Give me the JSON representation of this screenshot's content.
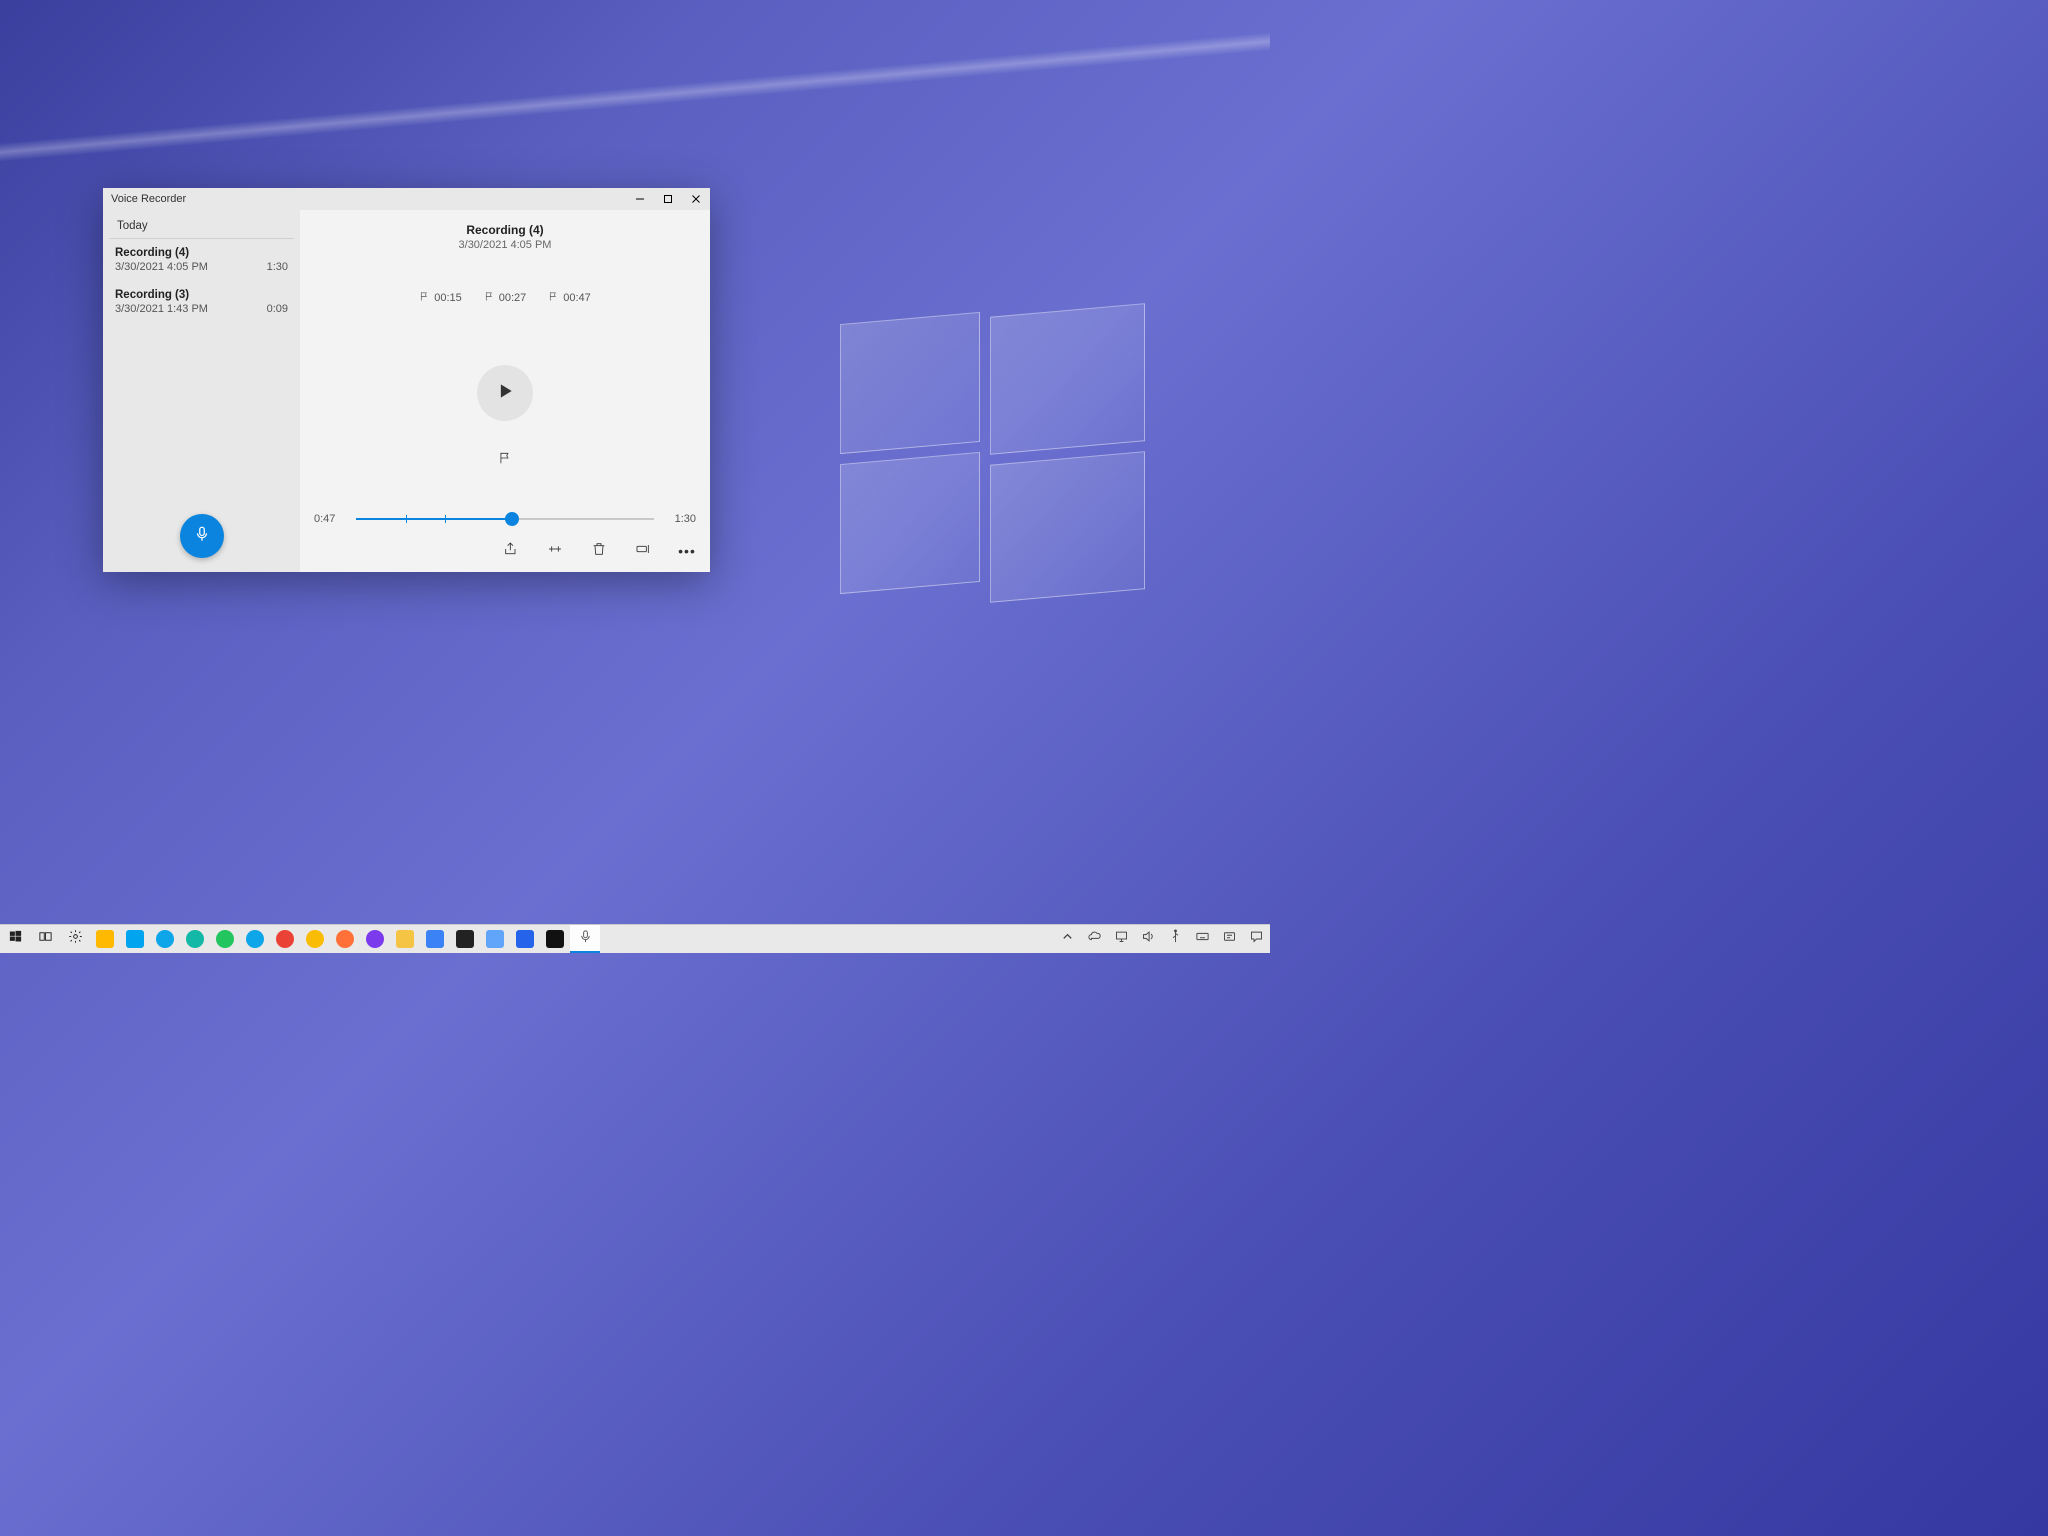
{
  "app": {
    "title": "Voice Recorder",
    "sidebar": {
      "section": "Today",
      "items": [
        {
          "name": "Recording (4)",
          "date": "3/30/2021 4:05 PM",
          "duration": "1:30",
          "selected": true
        },
        {
          "name": "Recording (3)",
          "date": "3/30/2021 1:43 PM",
          "duration": "0:09",
          "selected": false
        }
      ]
    },
    "detail": {
      "title": "Recording (4)",
      "date": "3/30/2021 4:05 PM",
      "markers": [
        "00:15",
        "00:27",
        "00:47"
      ],
      "current_time": "0:47",
      "total_time": "1:30",
      "progress_seconds": 47,
      "total_seconds": 90,
      "marker_seconds": [
        15,
        27,
        47
      ]
    }
  },
  "taskbar": {
    "apps": [
      {
        "name": "start",
        "kind": "svg-win",
        "color": "#222"
      },
      {
        "name": "task-view",
        "kind": "svg-taskview",
        "color": "#222"
      },
      {
        "name": "settings",
        "kind": "svg-gear",
        "color": "#222"
      },
      {
        "name": "store",
        "kind": "square",
        "color": "#ffb900"
      },
      {
        "name": "phone",
        "kind": "square",
        "color": "#00a4ef"
      },
      {
        "name": "edge",
        "kind": "circle",
        "color": "#0ea5e9"
      },
      {
        "name": "edge-dev",
        "kind": "circle",
        "color": "#14b8a6"
      },
      {
        "name": "edge-beta",
        "kind": "circle",
        "color": "#22c55e"
      },
      {
        "name": "edge-canary",
        "kind": "circle",
        "color": "#0ea5e9"
      },
      {
        "name": "chrome",
        "kind": "circle",
        "color": "#ea4335"
      },
      {
        "name": "chrome-canary",
        "kind": "circle",
        "color": "#fbbc05"
      },
      {
        "name": "firefox",
        "kind": "circle",
        "color": "#ff7139"
      },
      {
        "name": "firefox-dev",
        "kind": "circle",
        "color": "#7c3aed"
      },
      {
        "name": "explorer",
        "kind": "square",
        "color": "#f6c445"
      },
      {
        "name": "mail",
        "kind": "square",
        "color": "#3b82f6"
      },
      {
        "name": "terminal",
        "kind": "square",
        "color": "#222"
      },
      {
        "name": "app1",
        "kind": "square",
        "color": "#60a5fa"
      },
      {
        "name": "photos",
        "kind": "square",
        "color": "#2563eb"
      },
      {
        "name": "cmd",
        "kind": "square",
        "color": "#111"
      },
      {
        "name": "voice-recorder",
        "kind": "svg-mic",
        "color": "#555",
        "active": true
      }
    ],
    "tray": [
      "chevron-up",
      "onedrive",
      "network",
      "volume",
      "usb",
      "keyboard",
      "ime",
      "action-center"
    ]
  }
}
